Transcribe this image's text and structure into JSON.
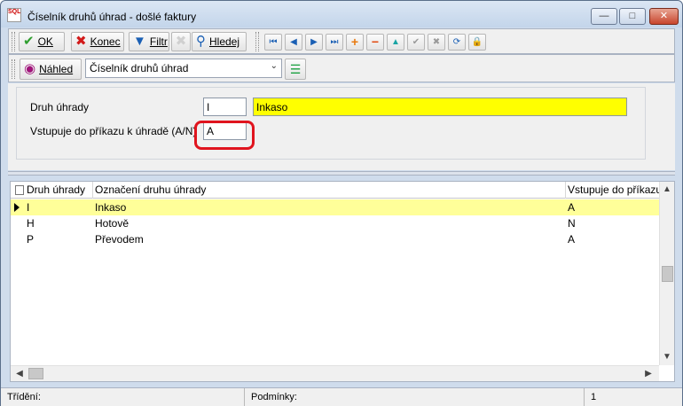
{
  "window": {
    "title": "Číselník druhů úhrad - došlé faktury",
    "app_icon_text": "SQL"
  },
  "toolbar": {
    "ok": {
      "label": "OK",
      "color": "#2e9e2e"
    },
    "konec": {
      "label": "Konec",
      "color": "#d21a1a"
    },
    "filtr": {
      "label": "Filtr",
      "color": "#1a5fb4"
    },
    "hledej": {
      "label": "Hledej",
      "color": "#1a5fb4"
    },
    "nav_icons": [
      "first-icon",
      "prev-icon",
      "next-icon",
      "last-icon",
      "add-icon",
      "delete-icon",
      "up-icon",
      "confirm-icon",
      "cancel-icon",
      "refresh-icon",
      "lock-icon"
    ]
  },
  "toolbar2": {
    "nahled": {
      "label": "Náhled",
      "color": "#a0147a"
    },
    "combo_value": "Číselník druhů úhrad"
  },
  "form": {
    "druh_label": "Druh úhrady",
    "druh_value": "I",
    "druh_name": "Inkaso",
    "vstupuje_label": "Vstupuje do příkazu k úhradě (A/N)",
    "vstupuje_value": "A"
  },
  "grid": {
    "columns": [
      "Druh úhrady",
      "Označení druhu úhrady",
      "Vstupuje do příkazu k úhradě"
    ],
    "rows": [
      {
        "druh": "I",
        "oznaceni": "Inkaso",
        "vstupuje": "A"
      },
      {
        "druh": "H",
        "oznaceni": "Hotově",
        "vstupuje": "N"
      },
      {
        "druh": "P",
        "oznaceni": "Převodem",
        "vstupuje": "A"
      }
    ],
    "selected_row_color": "#ffff99"
  },
  "status": {
    "trideni_label": "Třídění:",
    "podminky_label": "Podmínky:",
    "count": "1"
  },
  "colors": {
    "accent_yellow": "#ffff00",
    "highlight_ring": "#e0141e"
  }
}
